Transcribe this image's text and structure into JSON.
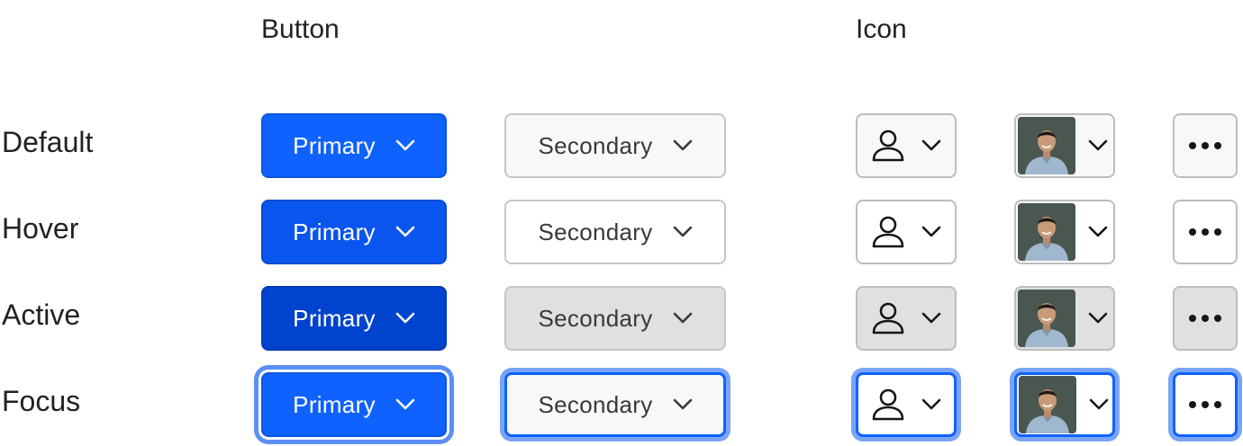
{
  "columns": {
    "button": "Button",
    "icon": "Icon"
  },
  "rows": [
    {
      "label": "Default"
    },
    {
      "label": "Hover"
    },
    {
      "label": "Active"
    },
    {
      "label": "Focus"
    }
  ],
  "buttons": {
    "primary_label": "Primary",
    "secondary_label": "Secondary"
  },
  "icons": {
    "user": "user-icon",
    "chevron": "chevron-down-icon",
    "avatar": "avatar-photo",
    "overflow": "overflow-menu-icon"
  },
  "colors": {
    "primary": "#0f62fe",
    "primary_hover": "#0b55ef",
    "primary_active": "#0043ce",
    "focus_ring": "#5b8ff5",
    "secondary_bg": "#f8f8f9",
    "secondary_active_bg": "#e0e0e2"
  }
}
